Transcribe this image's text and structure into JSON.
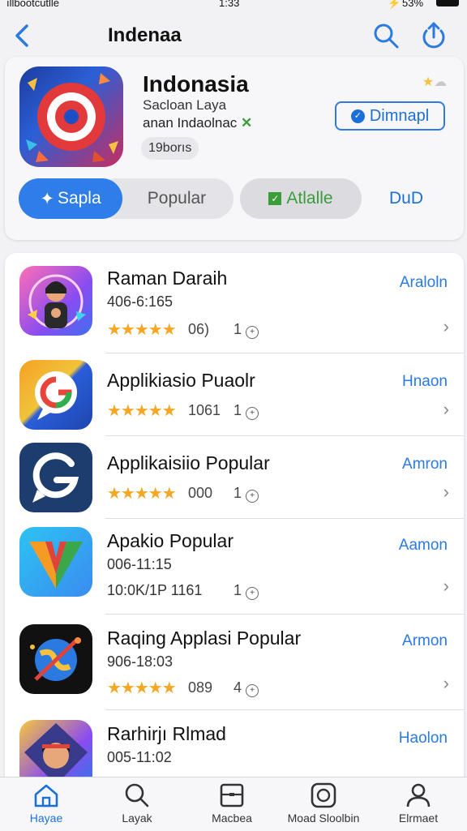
{
  "status": {
    "carrier": "ıllbootcutlle",
    "time": "1:33",
    "battery": "53%"
  },
  "nav": {
    "title": "Indenaa",
    "back": "back-icon",
    "search": "search-icon",
    "share": "share-icon"
  },
  "featured": {
    "name": "Indonasia",
    "subtitle1": "Sacloan Laya",
    "subtitle2": "anan Indaolnac",
    "badge": "19borıs",
    "button_label": "Dimnapl",
    "segments": [
      {
        "label": "Sapla",
        "active": true
      },
      {
        "label": "Popular"
      },
      {
        "label": "Atlalle"
      },
      {
        "label": "DuD"
      }
    ]
  },
  "apps": [
    {
      "name": "Raman Daraih",
      "meta": "406-6:165",
      "stars": 4.5,
      "count": "06)",
      "count2": "1",
      "action": "Araloln",
      "icon": "avatar-icon"
    },
    {
      "name": "Applikiasio Puaolr",
      "meta": "",
      "stars": 5,
      "count": "1061",
      "count2": "1",
      "action": "Hnaon",
      "icon": "chat-icon"
    },
    {
      "name": "Applikaisiio Popular",
      "meta": "",
      "stars": 4.5,
      "count": "000",
      "count2": "1",
      "action": "Amron",
      "icon": "g-chat-icon"
    },
    {
      "name": "Apakio Popular",
      "meta": "006-11:15",
      "meta2": "10:0K/1P 1161",
      "count2": "1",
      "action": "Aamon",
      "icon": "v-logo-icon"
    },
    {
      "name": "Raqing Applasi Popular",
      "meta": "906-18:03",
      "stars": 5,
      "count": "089",
      "count2": "4",
      "action": "Armon",
      "icon": "globe-icon"
    },
    {
      "name": "Rarhirjı Rlmad",
      "meta": "005-11:02",
      "action": "Haolon",
      "icon": "portrait-icon"
    }
  ],
  "tabs": [
    {
      "label": "Hayae",
      "icon": "home-icon",
      "active": true
    },
    {
      "label": "Layak",
      "icon": "search-icon"
    },
    {
      "label": "Macbea",
      "icon": "box-icon"
    },
    {
      "label": "Moad Sloolbin",
      "icon": "app-icon"
    },
    {
      "label": "Elrmaet",
      "icon": "person-icon"
    }
  ],
  "colors": {
    "accent": "#2a7ae2",
    "star": "#f5a623",
    "active_segment": "#2e7de8",
    "green": "#3a9d3a"
  }
}
